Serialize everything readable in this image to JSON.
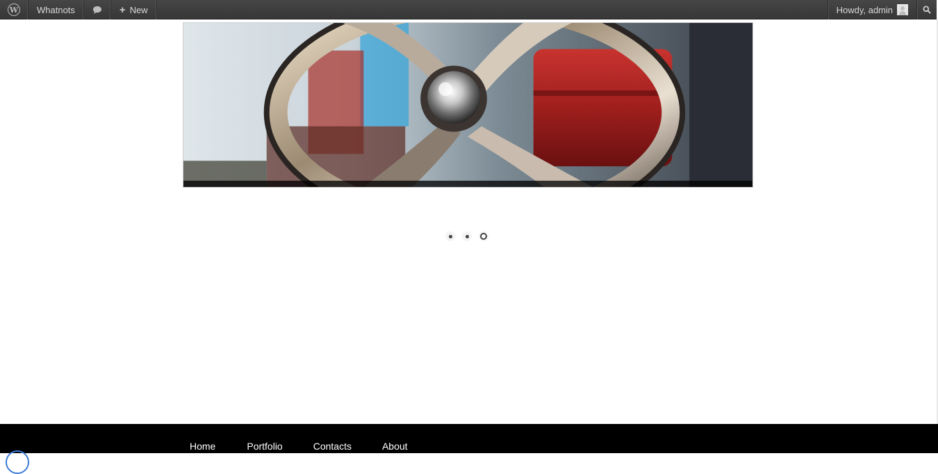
{
  "adminbar": {
    "wp_logo_icon": "wordpress-logo-icon",
    "wp_logo_glyph": "W",
    "site_name": "Whatnots",
    "comments_icon": "comment-bubble-icon",
    "new_label": "New",
    "new_icon": "plus-icon",
    "howdy_label": "Howdy, admin",
    "avatar_icon": "user-avatar-icon",
    "search_icon": "search-icon"
  },
  "slider": {
    "image_description_icon": "slide-image",
    "dots": [
      {
        "index": 1,
        "active": false
      },
      {
        "index": 2,
        "active": false
      },
      {
        "index": 3,
        "active": true
      }
    ]
  },
  "footer": {
    "nav": [
      {
        "label": "Home"
      },
      {
        "label": "Portfolio"
      },
      {
        "label": "Contacts"
      },
      {
        "label": "About"
      }
    ]
  },
  "colors": {
    "adminbar_bg": "#464646",
    "footer_bg": "#000000",
    "accent_red": "#b3262a"
  }
}
